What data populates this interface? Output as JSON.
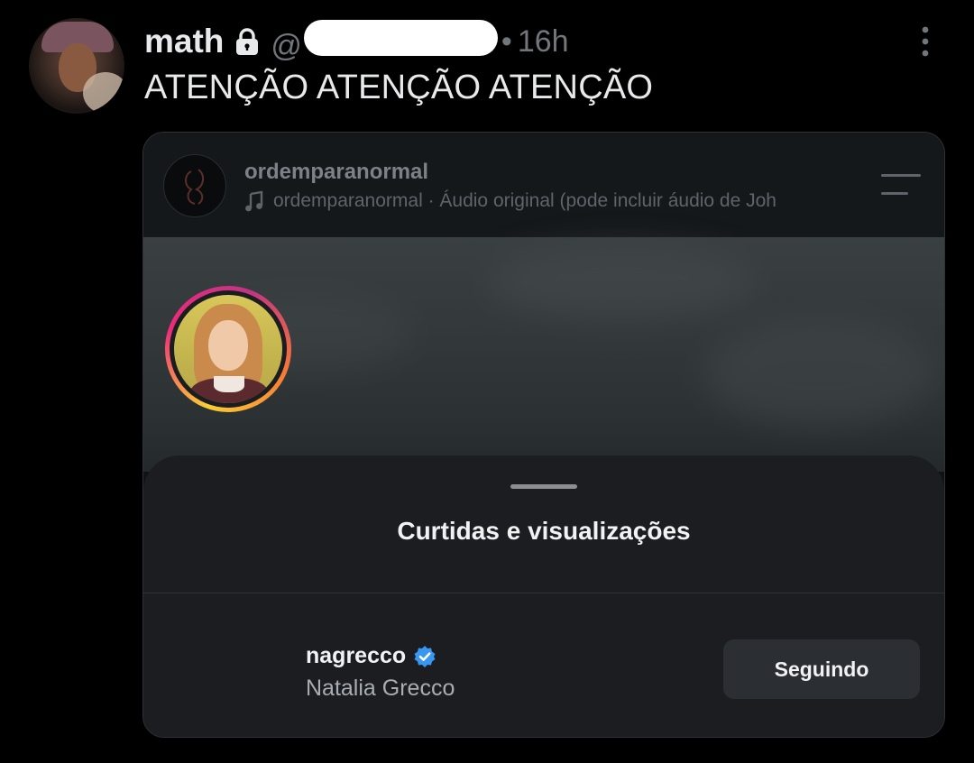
{
  "tweet": {
    "display_name": "math",
    "handle_prefix": "@",
    "separator": "•",
    "time": "16h",
    "text": "ATENÇÃO ATENÇÃO ATENÇÃO"
  },
  "reel": {
    "username": "ordemparanormal",
    "audio": "ordemparanormal · Áudio original  (pode incluir áudio de Joh"
  },
  "sheet": {
    "title": "Curtidas e visualizações",
    "user": {
      "username": "nagrecco",
      "full_name": "Natalia Grecco",
      "verified": true,
      "follow_label": "Seguindo"
    }
  },
  "colors": {
    "background": "#000000",
    "muted": "#71767b",
    "verified": "#3897f0",
    "sheet": "#1b1d20"
  },
  "icons": [
    "lock-icon",
    "more-icon",
    "music-icon",
    "menu-icon",
    "verified-icon"
  ]
}
